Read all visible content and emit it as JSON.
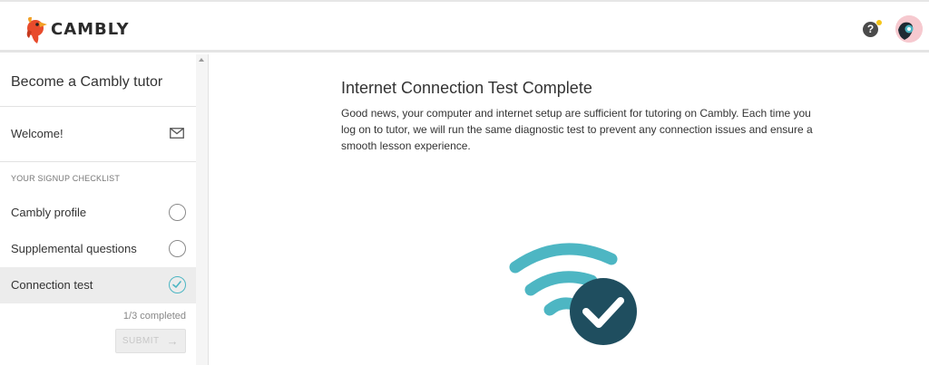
{
  "header": {
    "brand": "CAMBLY",
    "help_symbol": "?",
    "icons": {
      "help": "help-icon",
      "notification": "notification-dot",
      "avatar": "user-avatar",
      "logo": "cambly-bird-logo"
    },
    "colors": {
      "notif": "#f5c518",
      "avatar_bg": "#f6c9cf"
    }
  },
  "sidebar": {
    "title": "Become a Cambly tutor",
    "welcome": {
      "label": "Welcome!",
      "icon": "mail-icon"
    },
    "checklist_heading": "YOUR SIGNUP CHECKLIST",
    "items": [
      {
        "label": "Cambly profile",
        "done": false
      },
      {
        "label": "Supplemental questions",
        "done": false
      },
      {
        "label": "Connection test",
        "done": true
      }
    ],
    "progress": "1/3 completed",
    "submit_label": "SUBMIT"
  },
  "main": {
    "title": "Internet Connection Test Complete",
    "body": "Good news, your computer and internet setup are sufficient for tutoring on Cambly. Each time you log on to tutor, we will run the same diagnostic test to prevent any connection issues and ensure a smooth lesson experience.",
    "graphic": "wifi-check-icon",
    "colors": {
      "wifi": "#4db6c3",
      "check_circle": "#1f4e5f"
    }
  }
}
